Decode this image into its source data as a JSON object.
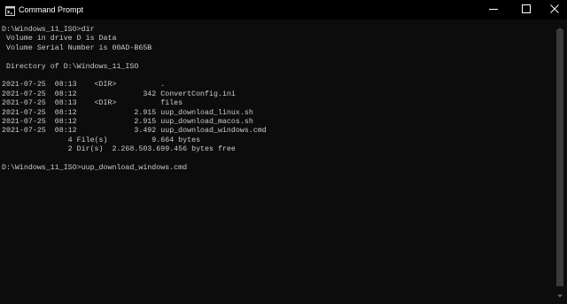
{
  "window": {
    "title": "Command Prompt",
    "icon": "console-icon",
    "controls": {
      "minimize_icon": "minimize-icon",
      "maximize_icon": "maximize-icon",
      "close_icon": "close-icon"
    }
  },
  "console": {
    "lines": [
      "D:\\Windows_11_ISO>dir",
      " Volume in drive D is Data",
      " Volume Serial Number is 00AD-B65B",
      "",
      " Directory of D:\\Windows_11_ISO",
      "",
      "2021-07-25  08:13    <DIR>          .",
      "2021-07-25  08:12               342 ConvertConfig.ini",
      "2021-07-25  08:13    <DIR>          files",
      "2021-07-25  08:12             2.915 uup_download_linux.sh",
      "2021-07-25  08:12             2.915 uup_download_macos.sh",
      "2021-07-25  08:12             3.492 uup_download_windows.cmd",
      "               4 File(s)          9.664 bytes",
      "               2 Dir(s)  2.268.503.699.456 bytes free",
      "",
      "D:\\Windows_11_ISO>uup_download_windows.cmd"
    ]
  },
  "colors": {
    "background": "#0c0c0c",
    "titlebar": "#000000",
    "text": "#cccccc",
    "scrollbar_thumb": "#3a3a3a"
  }
}
